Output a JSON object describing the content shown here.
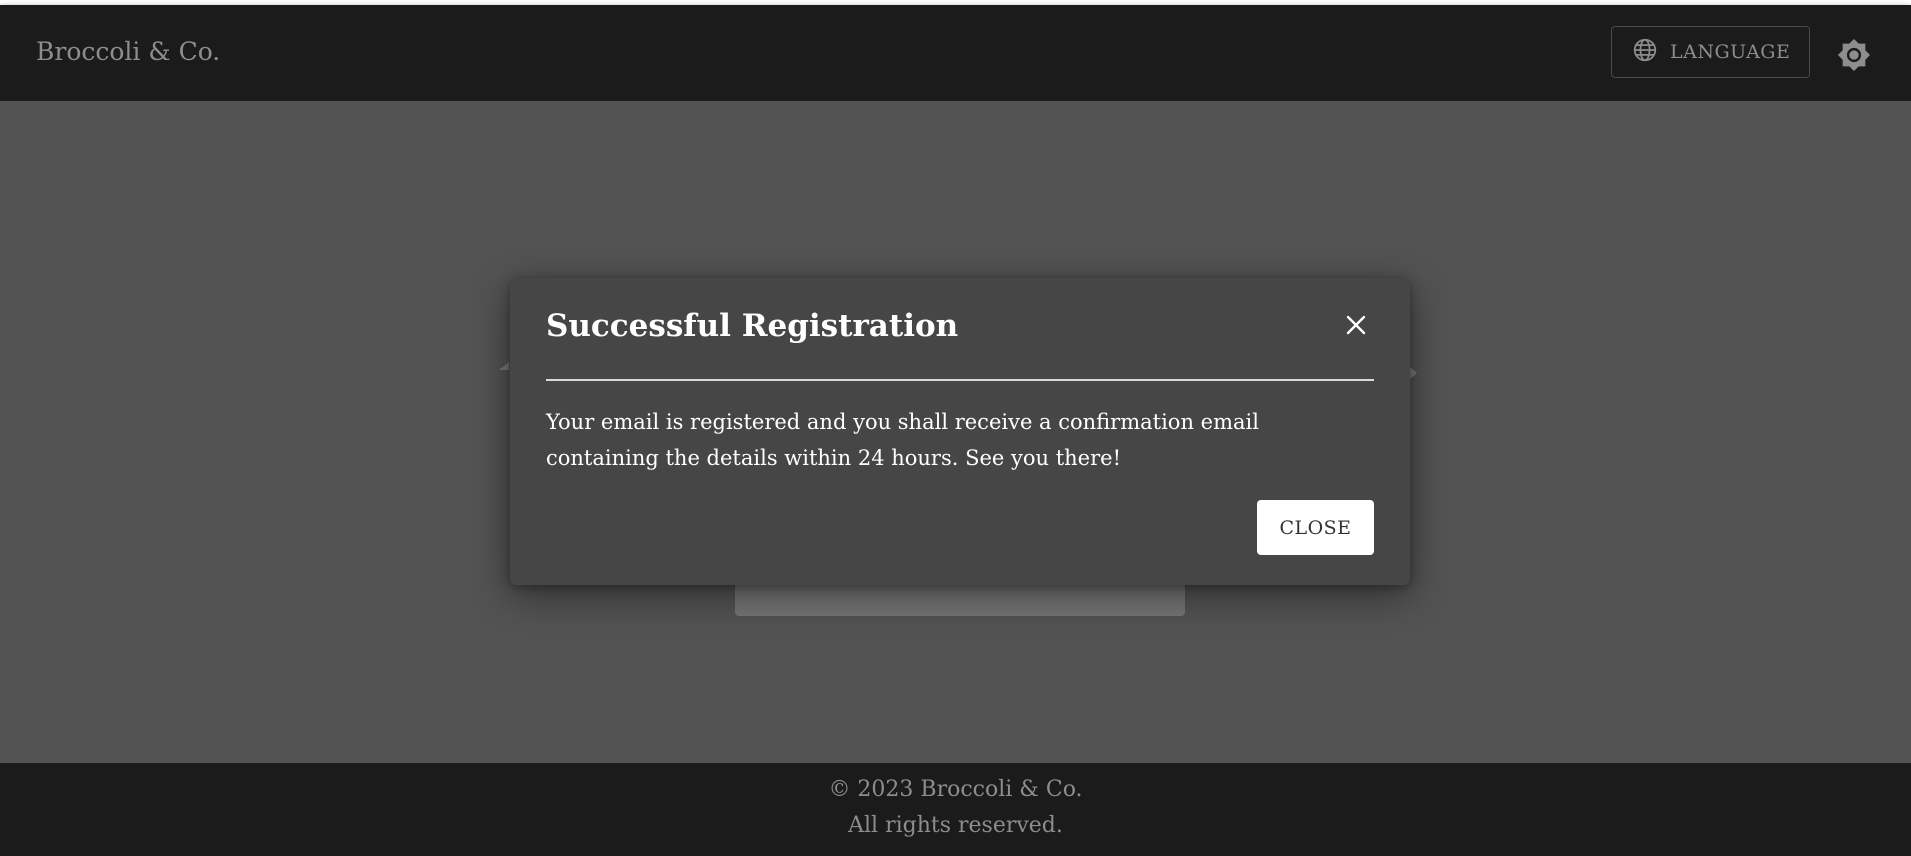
{
  "header": {
    "brand": "Broccoli & Co.",
    "language_label": "LANGUAGE",
    "language_icon": "globe-icon",
    "theme_icon": "brightness-icon"
  },
  "dialog": {
    "title": "Successful Registration",
    "close_icon": "close-icon",
    "body": "Your email is registered and you shall receive a confirmation email containing the details within 24 hours. See you there!",
    "close_button_label": "CLOSE"
  },
  "footer": {
    "copyright": "© 2023 Broccoli & Co.",
    "rights": "All rights reserved."
  },
  "colors": {
    "header_bg": "#1b1b1b",
    "backdrop": "#535353",
    "dialog_bg": "#464646",
    "muted_text": "#8d8d8d"
  }
}
